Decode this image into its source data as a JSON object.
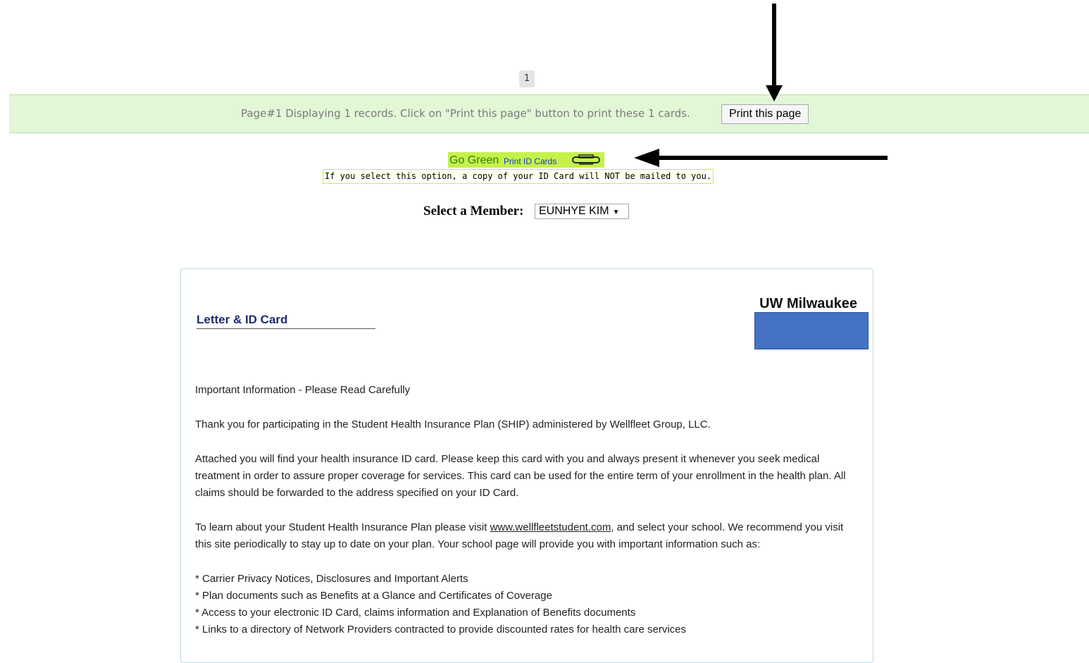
{
  "pager": {
    "current_page": "1"
  },
  "banner": {
    "text": "Page#1 Displaying 1 records. Click on \"Print this page\" button to print these 1 cards.",
    "print_button": "Print this page"
  },
  "go_green": {
    "label": "Go Green",
    "link": "Print ID Cards",
    "note": "If you select this option, a copy of your ID Card will NOT be mailed to you."
  },
  "member_select": {
    "label": "Select a Member:",
    "selected": "EUNHYE KIM"
  },
  "card": {
    "title": "Letter & ID Card",
    "school": "UW Milwaukee",
    "heading": "Important Information - Please Read Carefully",
    "para1": "Thank you for participating in the Student Health Insurance Plan (SHIP) administered by Wellfleet Group, LLC.",
    "para2": "Attached you will find your health insurance ID card. Please keep this card with you and always present it whenever you seek medical treatment in order to assure proper coverage for services. This card can be used for the entire term of your enrollment in the health plan. All claims should be forwarded to the address specified on your ID Card.",
    "para3_before": "To learn about your Student Health Insurance Plan please visit ",
    "para3_link": "www.wellfleetstudent.com",
    "para3_after": ", and select your school. We recommend you visit this site periodically to stay up to date on your plan. Your school page will provide you with important information such as:",
    "bullets": [
      "* Carrier Privacy Notices, Disclosures and Important Alerts",
      "* Plan documents such as Benefits at a Glance and Certificates of Coverage",
      "* Access to your electronic ID Card, claims information and Explanation of Benefits documents",
      "* Links to a directory of Network Providers contracted to provide discounted rates for health care services"
    ]
  },
  "colors": {
    "banner_bg": "#e2f7d6",
    "go_green_bg": "#c5f24a",
    "title_color": "#1c2d6e",
    "logo_fill": "#4472c4"
  }
}
